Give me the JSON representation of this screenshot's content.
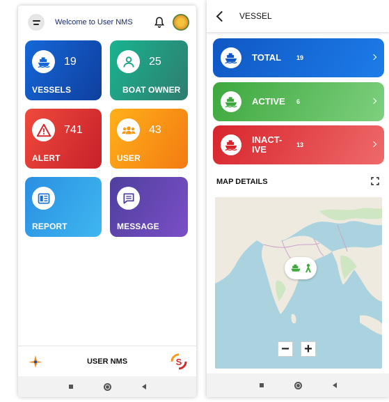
{
  "left_screen": {
    "header": {
      "title": "Welcome to User NMS",
      "menu_icon": "menu-icon",
      "bell_icon": "bell-icon",
      "emblem_icon": "state-emblem-icon"
    },
    "tiles": [
      {
        "label": "VESSELS",
        "count": "19",
        "icon": "ship-icon",
        "color": "#1567d8"
      },
      {
        "label": "BOAT OWNER",
        "count": "25",
        "icon": "person-icon",
        "color": "#19b38f"
      },
      {
        "label": "ALERT",
        "count": "741",
        "icon": "warning-icon",
        "color": "#ef4a3c"
      },
      {
        "label": "USER",
        "count": "43",
        "icon": "group-icon",
        "color": "#ffb01a"
      },
      {
        "label": "REPORT",
        "count": "",
        "icon": "report-icon",
        "color": "#2a8fe2"
      },
      {
        "label": "MESSAGE",
        "count": "",
        "icon": "message-icon",
        "color": "#6a47b8"
      }
    ],
    "footer": {
      "title": "USER NMS",
      "left_logo": "isro-logo-icon",
      "right_logo": "s-logo-icon"
    },
    "nav": {
      "square": "recent-apps-icon",
      "circle": "home-icon",
      "triangle": "back-icon"
    }
  },
  "right_screen": {
    "header": {
      "title": "VESSEL",
      "back_icon": "back-chevron-icon"
    },
    "cards": [
      {
        "label": "TOTAL",
        "count": "19",
        "icon": "ship-icon",
        "color": "#0f57c4"
      },
      {
        "label": "ACTIVE",
        "count": "6",
        "icon": "ship-icon",
        "color": "#3da83d"
      },
      {
        "label": "INACT-\nIVE",
        "count": "13",
        "icon": "ship-icon",
        "color": "#d8242c"
      }
    ],
    "map": {
      "title": "MAP DETAILS",
      "zoom_out": "−",
      "zoom_in": "+",
      "expand_icon": "fullscreen-icon",
      "marker_icon": "vessel-marker-icon"
    }
  }
}
